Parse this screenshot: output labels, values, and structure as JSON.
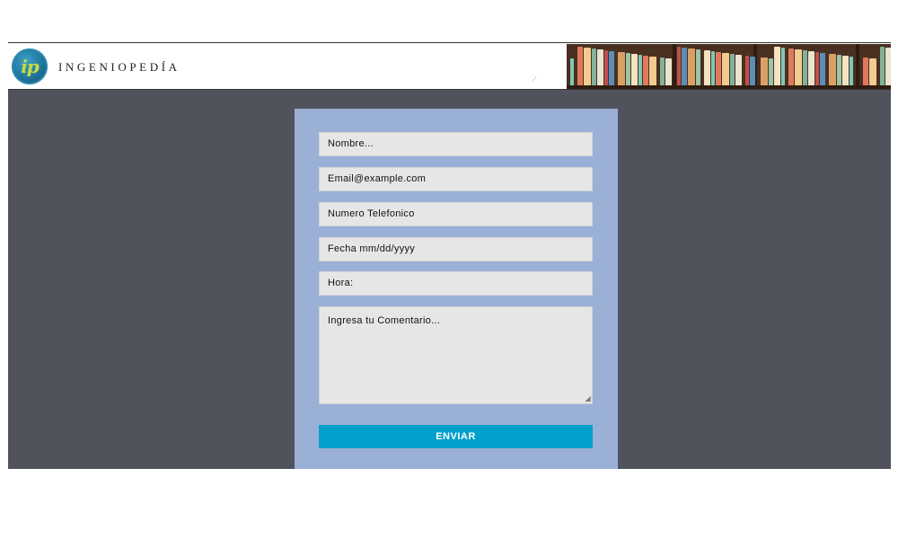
{
  "header": {
    "logo_text": "ip",
    "brand_name": "INGENIOPEDÍA",
    "banner_icon": "bookshelf-banner"
  },
  "form": {
    "fields": {
      "name_placeholder": "Nombre...",
      "email_placeholder": "Email@example.com",
      "phone_placeholder": "Numero Telefonico",
      "date_placeholder": "Fecha mm/dd/yyyy",
      "time_placeholder": "Hora:",
      "comment_placeholder": "Ingresa tu Comentario..."
    },
    "submit_label": "ENVIAR"
  },
  "colors": {
    "page_background": "#50535c",
    "form_background": "#9ab0d6",
    "field_background": "#e6e6e6",
    "button_background": "#03a0cc",
    "logo_accent": "#c8dc3a"
  }
}
